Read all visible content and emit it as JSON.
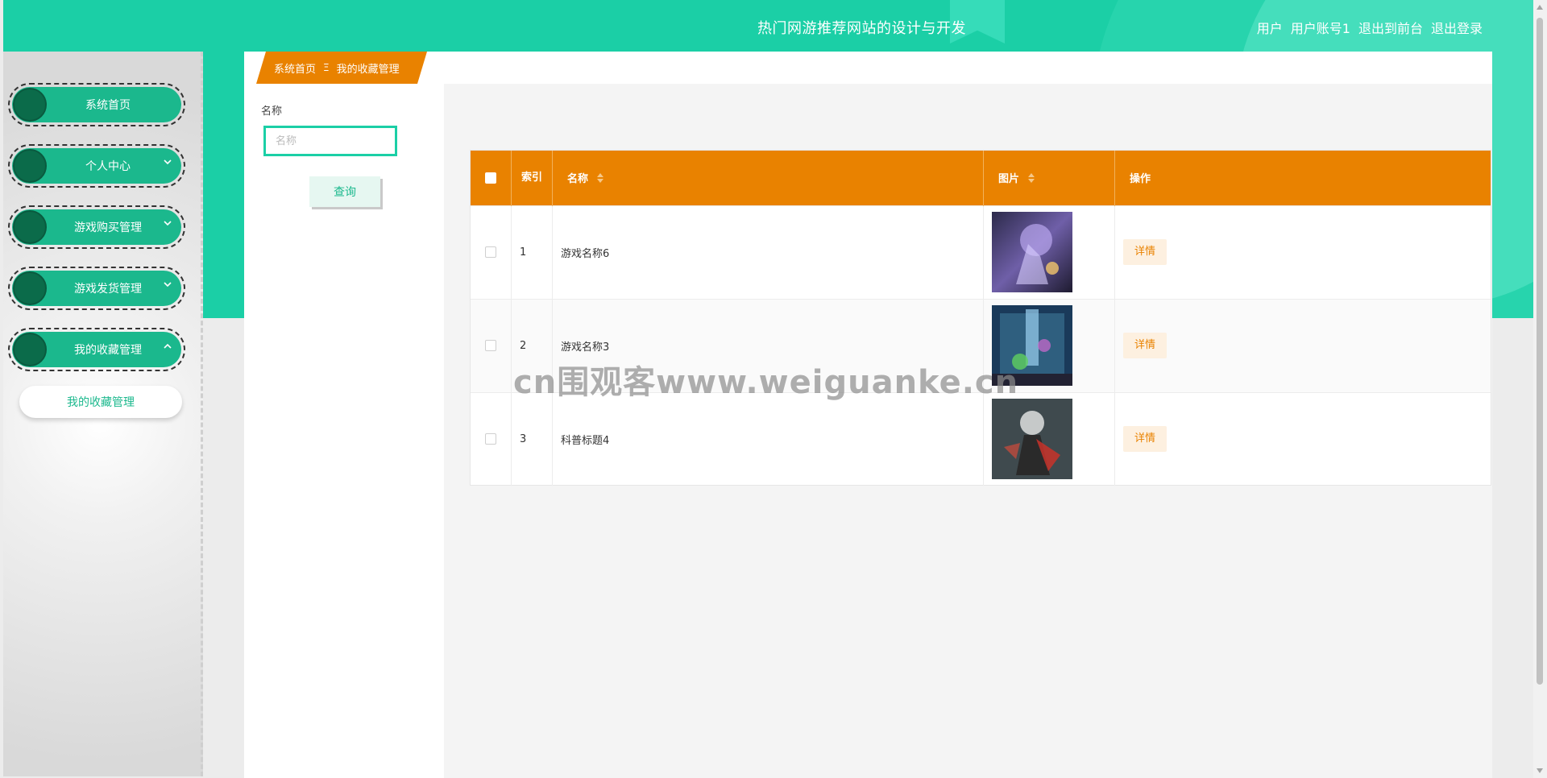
{
  "header": {
    "title": "热门网游推荐网站的设计与开发",
    "user_role": "用户",
    "user_account": "用户账号1",
    "back_to_front": "退出到前台",
    "logout": "退出登录"
  },
  "sidebar": {
    "items": [
      {
        "label": "系统首页",
        "expandable": false
      },
      {
        "label": "个人中心",
        "expandable": true,
        "chevron": "chevron-down-icon"
      },
      {
        "label": "游戏购买管理",
        "expandable": true,
        "chevron": "chevron-down-icon"
      },
      {
        "label": "游戏发货管理",
        "expandable": true,
        "chevron": "chevron-down-icon"
      },
      {
        "label": "我的收藏管理",
        "expandable": true,
        "chevron": "chevron-up-icon"
      }
    ],
    "submenu": [
      "我的收藏管理"
    ]
  },
  "breadcrumb": {
    "home": "系统首页",
    "separator": "Ξ",
    "current": "我的收藏管理"
  },
  "search": {
    "label": "名称",
    "placeholder": "名称",
    "value": "",
    "query_button": "查询"
  },
  "table": {
    "columns": {
      "index": "索引",
      "name": "名称",
      "image": "图片",
      "actions": "操作"
    },
    "rows": [
      {
        "index": "1",
        "name": "游戏名称6",
        "action": "详情"
      },
      {
        "index": "2",
        "name": "游戏名称3",
        "action": "详情"
      },
      {
        "index": "3",
        "name": "科普标题4",
        "action": "详情"
      }
    ]
  },
  "watermark": "cn围观客www.weiguanke.cn",
  "colors": {
    "header_teal": "#1bcfa6",
    "menu_green": "#1bb88d",
    "accent_orange": "#e98200"
  }
}
